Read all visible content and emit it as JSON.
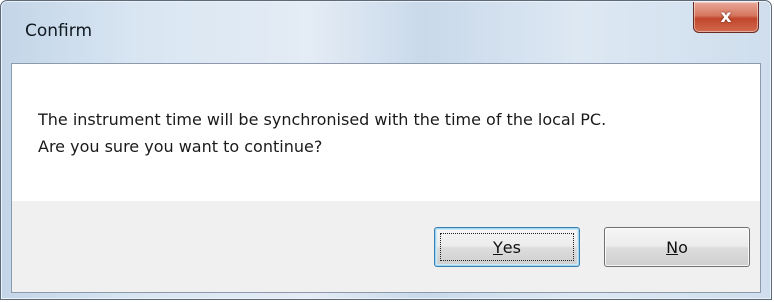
{
  "window": {
    "title": "Confirm",
    "close_label": "x"
  },
  "message": {
    "line1": "The instrument time will be synchronised with the time of the local PC.",
    "line2": "Are you sure you want to continue?"
  },
  "buttons": {
    "yes": {
      "mnemonic": "Y",
      "rest": "es"
    },
    "no": {
      "mnemonic": "N",
      "rest": "o"
    }
  },
  "colors": {
    "close_button": "#c0462c",
    "default_button_border": "#3c7fb1"
  }
}
